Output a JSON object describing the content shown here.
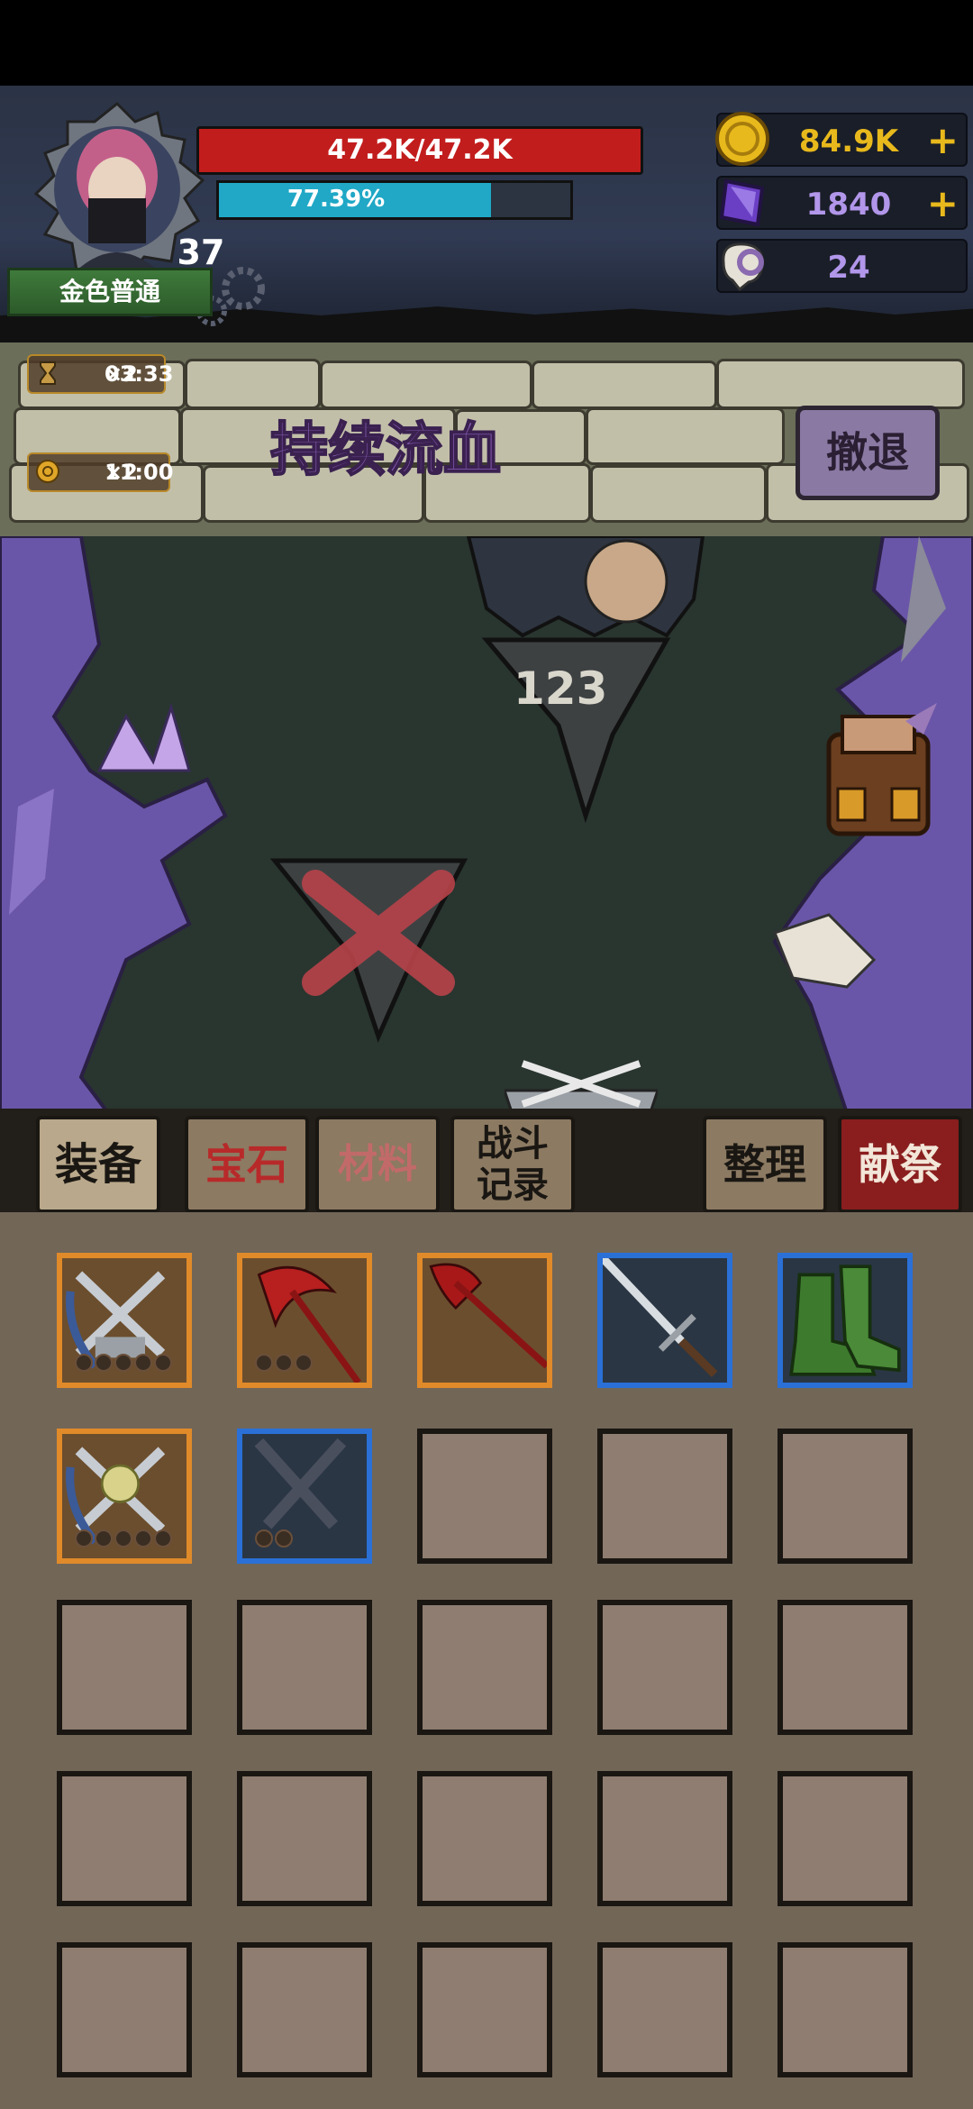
{
  "player": {
    "hp_text": "47.2K/47.2K",
    "hp_fraction": 1.0,
    "xp_text": "77.39%",
    "xp_fraction": 0.7739,
    "level": "37",
    "rank": "金色普通"
  },
  "resources": {
    "gold": "84.9K",
    "gems": "1840",
    "keys": "24"
  },
  "boosts": [
    {
      "label": "×2",
      "time": "03:33",
      "icon": "hourglass-icon"
    },
    {
      "label": "×2",
      "time": "11:00",
      "icon": "coin-boost-icon"
    }
  ],
  "event": {
    "title": "持续流血",
    "retreat_label": "撤退"
  },
  "battle": {
    "damage_number": "123"
  },
  "tabs": {
    "equipment": "装备",
    "gems": "宝石",
    "materials": "材料",
    "battle_log_1": "战斗",
    "battle_log_2": "记录",
    "sort": "整理",
    "sacrifice": "献祭"
  },
  "colors": {
    "hp": "#c21d1d",
    "xp": "#20a8c6",
    "gold": "#e8b91c",
    "orange_rarity": "#e08a2a",
    "blue_rarity": "#2a70d6"
  },
  "inventory": [
    {
      "item": "crossed-swords-dragon",
      "rarity": "orange",
      "stars": 5
    },
    {
      "item": "red-scythe",
      "rarity": "orange",
      "stars": 3
    },
    {
      "item": "red-axe",
      "rarity": "orange",
      "stars": 0
    },
    {
      "item": "steel-sword",
      "rarity": "blue",
      "stars": 0
    },
    {
      "item": "green-boots",
      "rarity": "blue",
      "stars": 0
    },
    {
      "item": "crossed-swords-dragon-gem",
      "rarity": "orange",
      "stars": 5
    },
    {
      "item": "dark-crossed-swords",
      "rarity": "blue",
      "stars": 2
    }
  ]
}
